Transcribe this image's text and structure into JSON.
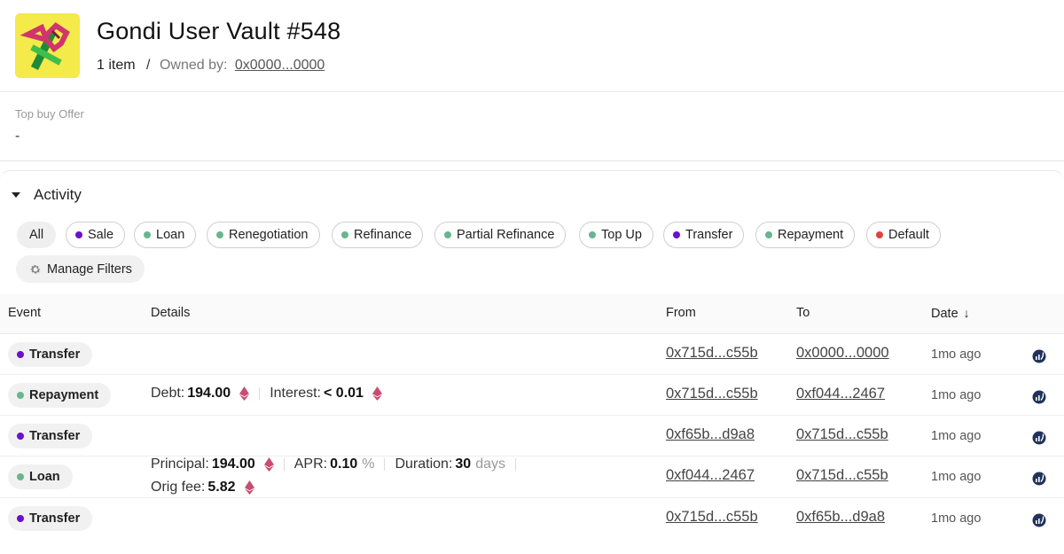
{
  "header": {
    "title": "Gondi User Vault #548",
    "item_count": "1 item",
    "separator": "/",
    "owned_label": "Owned by:",
    "owner_address": "0x0000...0000"
  },
  "offer": {
    "label": "Top buy Offer",
    "value": "-"
  },
  "activity": {
    "title": "Activity",
    "filters": [
      {
        "label": "All"
      },
      {
        "label": "Sale",
        "color": "#6a11c9"
      },
      {
        "label": "Loan",
        "color": "#6ab58e"
      },
      {
        "label": "Renegotiation",
        "color": "#6ab58e"
      },
      {
        "label": "Refinance",
        "color": "#6ab58e"
      },
      {
        "label": "Partial Refinance",
        "color": "#6ab58e"
      },
      {
        "label": "Top Up",
        "color": "#6ab58e"
      },
      {
        "label": "Transfer",
        "color": "#6a11c9"
      },
      {
        "label": "Repayment",
        "color": "#6ab58e"
      },
      {
        "label": "Default",
        "color": "#d9463e"
      }
    ],
    "manage_filters": "Manage Filters"
  },
  "table": {
    "columns": {
      "event": "Event",
      "details": "Details",
      "from": "From",
      "to": "To",
      "date": "Date",
      "sort_icon": "↓"
    },
    "rows": [
      {
        "event": "Transfer",
        "color": "#6a11c9",
        "from": "0x715d...c55b",
        "to": "0x0000...0000",
        "date": "1mo ago"
      },
      {
        "event": "Repayment",
        "color": "#6ab58e",
        "debt_label": "Debt:",
        "debt_value": "194.00",
        "interest_label": "Interest:",
        "interest_value": "< 0.01",
        "from": "0x715d...c55b",
        "to": "0xf044...2467",
        "date": "1mo ago"
      },
      {
        "event": "Transfer",
        "color": "#6a11c9",
        "from": "0xf65b...d9a8",
        "to": "0x715d...c55b",
        "date": "1mo ago"
      },
      {
        "event": "Loan",
        "color": "#6ab58e",
        "principal_label": "Principal:",
        "principal_value": "194.00",
        "apr_label": "APR:",
        "apr_value": "0.10",
        "apr_unit": "%",
        "duration_label": "Duration:",
        "duration_value": "30",
        "duration_unit": "days",
        "fee_label": "Orig fee:",
        "fee_value": "5.82",
        "from": "0xf044...2467",
        "to": "0x715d...c55b",
        "date": "1mo ago"
      },
      {
        "event": "Transfer",
        "color": "#6a11c9",
        "from": "0x715d...c55b",
        "to": "0xf65b...d9a8",
        "date": "1mo ago"
      }
    ]
  },
  "icons": {
    "eth": "ethereum-icon",
    "external": "etherscan-icon",
    "gear": "gear-icon",
    "caret": "caret-down-icon"
  },
  "colors": {
    "logo_bg": "#f4ea4a",
    "eth_pink": "#c74d72"
  }
}
